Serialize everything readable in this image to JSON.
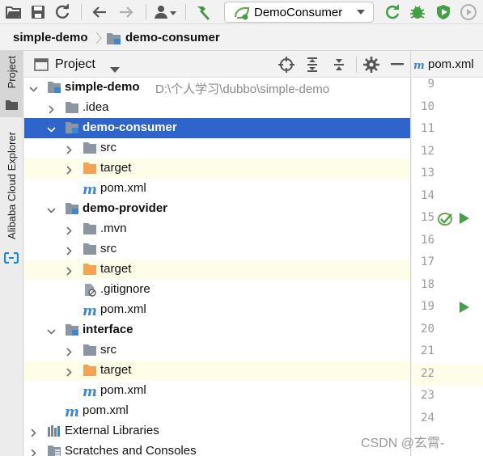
{
  "colors": {
    "selection": "#2f65ca",
    "excluded_row": "#fdfde8",
    "folder_blue": "#8c96a3",
    "folder_orange": "#f5a255",
    "maven_blue": "#3e86cf",
    "green": "#43a047"
  },
  "toolbar": {
    "icons": [
      "open-folder-icon",
      "save-icon",
      "sync-icon",
      "back-arrow-icon",
      "forward-arrow-icon",
      "vcs-user-icon",
      "build-hammer-icon",
      "rerun-icon",
      "debug-bug-icon",
      "coverage-icon",
      "profile-icon"
    ],
    "run_config_label": "DemoConsumer"
  },
  "breadcrumb": {
    "root": "simple-demo",
    "child": "demo-consumer"
  },
  "side_strip": {
    "project_tab": "Project",
    "alibaba_tab": "Alibaba Cloud Explorer"
  },
  "panel": {
    "title": "Project"
  },
  "tree": [
    {
      "label": "simple-demo",
      "path": "D:\\个人学习\\dubbo\\simple-demo",
      "expanded": true,
      "bold": true,
      "icon": "module-folder-icon",
      "depth": 0
    },
    {
      "label": ".idea",
      "expanded": false,
      "icon": "folder-icon",
      "depth": 1
    },
    {
      "label": "demo-consumer",
      "expanded": true,
      "bold": true,
      "icon": "module-folder-icon",
      "depth": 1,
      "selected": true
    },
    {
      "label": "src",
      "expanded": false,
      "icon": "folder-icon",
      "depth": 2
    },
    {
      "label": "target",
      "expanded": false,
      "icon": "excluded-folder-icon",
      "depth": 2,
      "excluded": true
    },
    {
      "label": "pom.xml",
      "icon": "maven-icon",
      "depth": 2,
      "leaf": true
    },
    {
      "label": "demo-provider",
      "expanded": true,
      "bold": true,
      "icon": "module-folder-icon",
      "depth": 1
    },
    {
      "label": ".mvn",
      "expanded": false,
      "icon": "folder-icon",
      "depth": 2
    },
    {
      "label": "src",
      "expanded": false,
      "icon": "folder-icon",
      "depth": 2
    },
    {
      "label": "target",
      "expanded": false,
      "icon": "excluded-folder-icon",
      "depth": 2,
      "excluded": true
    },
    {
      "label": ".gitignore",
      "icon": "ignored-file-icon",
      "depth": 2,
      "leaf": true
    },
    {
      "label": "pom.xml",
      "icon": "maven-icon",
      "depth": 2,
      "leaf": true
    },
    {
      "label": "interface",
      "expanded": true,
      "bold": true,
      "icon": "module-folder-icon",
      "depth": 1
    },
    {
      "label": "src",
      "expanded": false,
      "icon": "folder-icon",
      "depth": 2
    },
    {
      "label": "target",
      "expanded": false,
      "icon": "excluded-folder-icon",
      "depth": 2,
      "excluded": true
    },
    {
      "label": "pom.xml",
      "icon": "maven-icon",
      "depth": 2,
      "leaf": true
    },
    {
      "label": "pom.xml",
      "icon": "maven-icon",
      "depth": 1,
      "leaf": true
    },
    {
      "label": "External Libraries",
      "expanded": false,
      "icon": "libraries-icon",
      "depth": 0
    },
    {
      "label": "Scratches and Consoles",
      "expanded": false,
      "icon": "scratches-icon",
      "depth": 0
    }
  ],
  "editor": {
    "tab_label": "pom.xml",
    "line_numbers": [
      "9",
      "10",
      "11",
      "12",
      "13",
      "14",
      "15",
      "16",
      "17",
      "18",
      "19",
      "20",
      "21",
      "22",
      "23",
      "24"
    ],
    "current_line": "22",
    "gutter_marks": [
      {
        "line": "15",
        "icons": [
          "bean-check-icon",
          "run-gutter-icon"
        ]
      },
      {
        "line": "19",
        "icons": [
          "run-gutter-icon"
        ]
      }
    ]
  },
  "watermark": "CSDN @玄霄-"
}
